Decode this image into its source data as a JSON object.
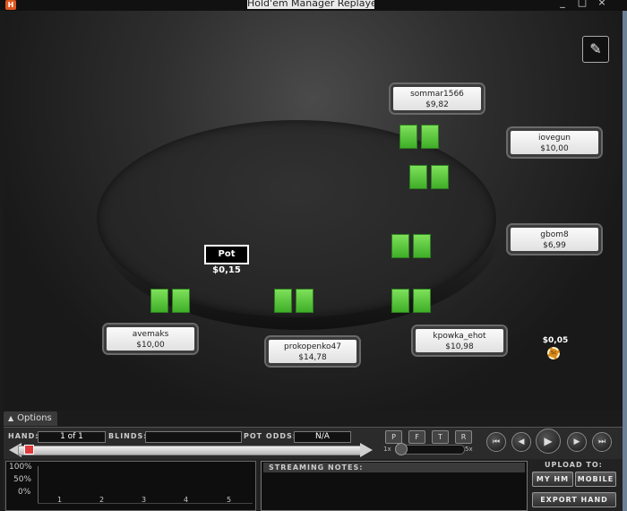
{
  "window": {
    "title": "Hold'em Manager Replayer",
    "icon": "app-logo-icon",
    "controls": [
      "_",
      "□",
      "×"
    ]
  },
  "pot": {
    "label": "Pot $0,15"
  },
  "seats": [
    {
      "name": "sommar1566",
      "stack": "$9,82"
    },
    {
      "name": "iovegun",
      "stack": "$10,00"
    },
    {
      "name": "gbom8",
      "stack": "$6,99"
    },
    {
      "name": "kpowka_ehot",
      "stack": "$10,98"
    },
    {
      "name": "prokopenko47",
      "stack": "$14,78"
    },
    {
      "name": "avemaks",
      "stack": "$10,00"
    }
  ],
  "bet": {
    "amount": "$0,05",
    "chip_label": "5c"
  },
  "options": {
    "label": "Options",
    "icon": "triangle-up-icon"
  },
  "controls": {
    "hand_label": "HAND:",
    "hand_value": "1 of 1",
    "blinds_label": "BLINDS:",
    "blinds_value": "",
    "pot_odds_label": "POT ODDS:",
    "pot_odds_value": "N/A",
    "toggles": [
      "P",
      "F",
      "T",
      "R"
    ],
    "speed_min": "1x",
    "speed_max": "5x",
    "speed_level": 0,
    "progress": 0
  },
  "playback": {
    "first": "⏮",
    "prev": "◀",
    "play": "▶",
    "next": "▶",
    "last": "⏭"
  },
  "graph": {
    "y_labels": [
      "100%",
      "50%",
      "0%"
    ],
    "x_labels": [
      "1",
      "2",
      "3",
      "4",
      "5"
    ]
  },
  "notes": {
    "header": "STREAMING NOTES:"
  },
  "upload": {
    "label": "UPLOAD TO:",
    "my_hm": "MY HM",
    "mobile": "MOBILE",
    "export": "EXPORT HAND"
  }
}
